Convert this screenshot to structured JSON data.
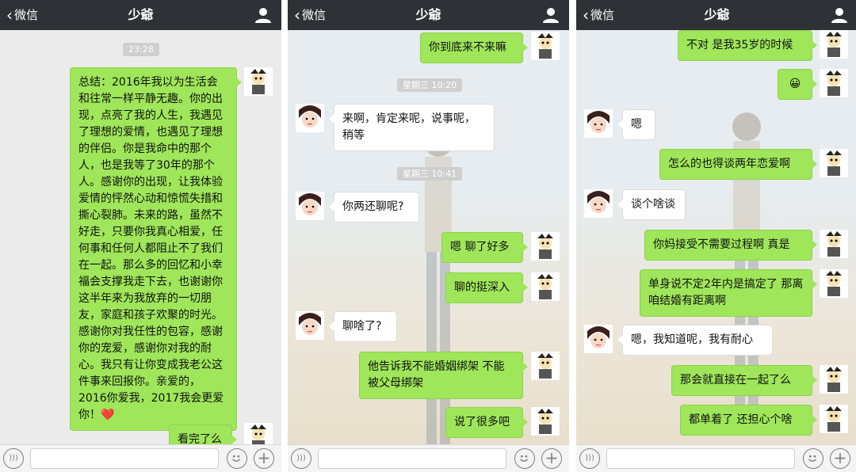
{
  "nav": {
    "back_label": "微信",
    "title": "少爺"
  },
  "panels": [
    {
      "time_labels": [
        "23:28"
      ],
      "messages": [
        {
          "side": "me",
          "text": "总结：2016年我以为生活会和往常一样平静无趣。你的出现，点亮了我的人生，我遇见了理想的爱情，也遇见了理想的伴侣。你是我命中的那个人，也是我等了30年的那个人。感谢你的出现，让我体验爱情的怦然心动和惊慌失措和撕心裂肺。未来的路，虽然不好走，只要你我真心相爱，任何事和任何人都阻止不了我们在一起。那么多的回忆和小幸福会支撑我走下去，也谢谢你这半年来为我放弃的一切朋友，家庭和孩子欢聚的时光。感谢你对我任性的包容，感谢你的宠爱，感谢你对我的耐心。我只有让你变成我老公这件事来回报你。亲爱的，2016你爱我，2017我会更爱你！❤️"
        },
        {
          "side": "me",
          "text": "看完了么"
        }
      ]
    },
    {
      "time_labels": [
        "星期三 10:20",
        "星期三 10:41"
      ],
      "messages": [
        {
          "side": "me",
          "text": "你到底来不来嘛"
        },
        {
          "side": "other",
          "text": "来啊，肯定来呢，说事呢，稍等"
        },
        {
          "side": "other",
          "text": "你两还聊呢?"
        },
        {
          "side": "me",
          "text": "嗯 聊了好多"
        },
        {
          "side": "me",
          "text": "聊的挺深入"
        },
        {
          "side": "other",
          "text": "聊啥了?"
        },
        {
          "side": "me",
          "text": "他告诉我不能婚姻绑架 不能被父母绑架"
        },
        {
          "side": "me",
          "text": "说了很多吧"
        }
      ]
    },
    {
      "time_labels": [],
      "messages": [
        {
          "side": "me",
          "text": "不对 是我35岁的时候"
        },
        {
          "side": "me",
          "text": "😀"
        },
        {
          "side": "other",
          "text": "嗯"
        },
        {
          "side": "me",
          "text": "怎么的也得谈两年恋爱啊"
        },
        {
          "side": "other",
          "text": "谈个啥谈"
        },
        {
          "side": "me",
          "text": "你妈接受不需要过程啊 真是"
        },
        {
          "side": "me",
          "text": "单身说不定2年内是搞定了 那离咱结婚有距离啊"
        },
        {
          "side": "other",
          "text": "嗯，我知道呢，我有耐心"
        },
        {
          "side": "me",
          "text": "那会就直接在一起了么"
        },
        {
          "side": "me",
          "text": "都单着了 还担心个啥"
        }
      ]
    }
  ],
  "icons": {
    "profile": "person-icon",
    "voice": "voice-icon",
    "emoji": "emoji-face-icon",
    "plus": "plus-icon",
    "back": "chevron-left-icon"
  },
  "colors": {
    "navbar": "#2e3135",
    "bubble_me": "#9fe65a",
    "bubble_other": "#ffffff"
  }
}
